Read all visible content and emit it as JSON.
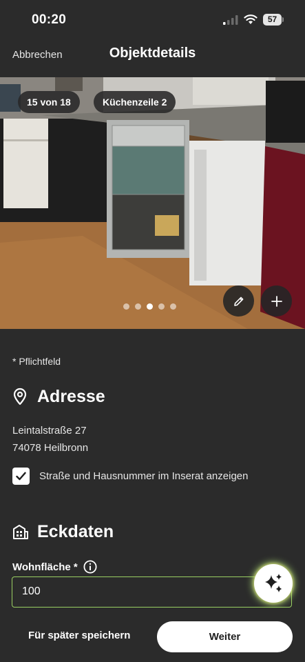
{
  "status_bar": {
    "time": "00:20",
    "battery": "57",
    "icons": [
      "signal-icon",
      "wifi-icon",
      "battery-icon"
    ]
  },
  "nav": {
    "cancel": "Abbrechen",
    "title": "Objektdetails"
  },
  "gallery": {
    "counter": "15 von 18",
    "room_tag": "Küchenzeile 2",
    "dots_total": 5,
    "dots_active_index": 2,
    "icons": [
      "pencil-icon",
      "plus-icon"
    ]
  },
  "form": {
    "required_note": "* Pflichtfeld",
    "address": {
      "heading": "Adresse",
      "icon": "location-pin-icon",
      "street": "Leintalstraße 27",
      "city": "74078 Heilbronn",
      "show_address_label": "Straße und Hausnummer im Inserat anzeigen",
      "show_address_checked": true
    },
    "key_data": {
      "heading": "Eckdaten",
      "icon": "building-icon",
      "living_area_label": "Wohnfläche *",
      "living_area_value": "100",
      "info_icon": "info-icon"
    }
  },
  "ai_assist_icon": "sparkles-icon",
  "footer": {
    "save_later": "Für später speichern",
    "next": "Weiter"
  },
  "colors": {
    "background": "#2b2b2b",
    "input_border": "#9bd163",
    "button_primary": "#ffffff"
  }
}
